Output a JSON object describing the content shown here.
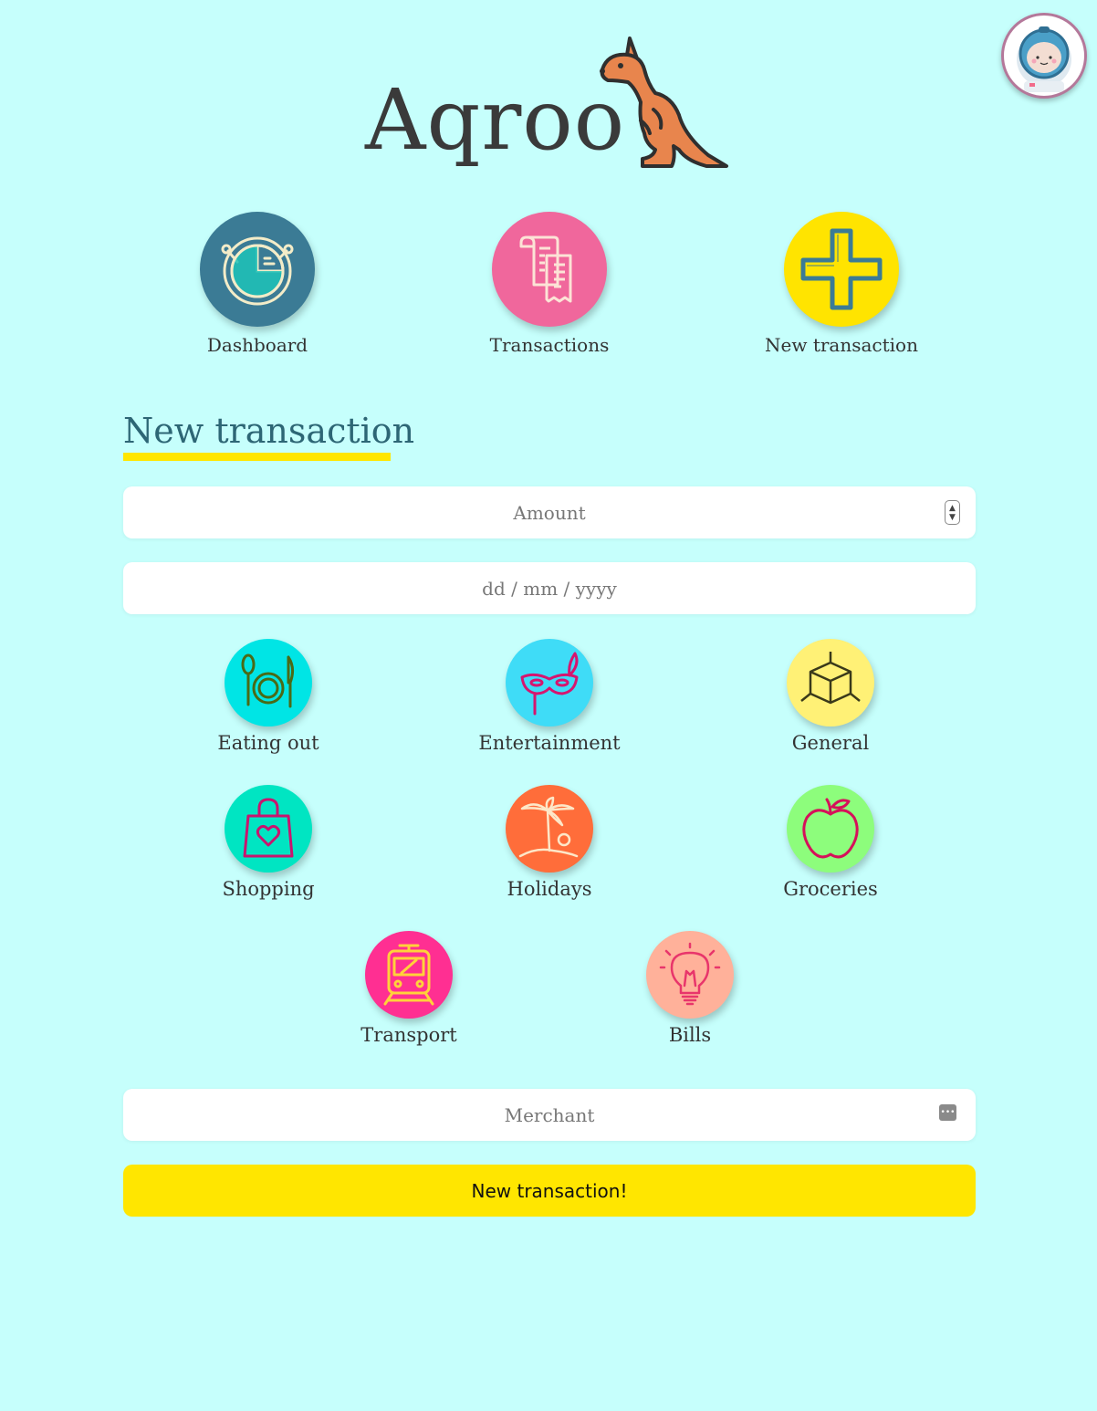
{
  "app": {
    "title": "Aqroo"
  },
  "nav": {
    "items": [
      {
        "label": "Dashboard",
        "color": "#3b7b95",
        "icon": "pie-chart-icon"
      },
      {
        "label": "Transactions",
        "color": "#f0679c",
        "icon": "receipt-icon"
      },
      {
        "label": "New transaction",
        "color": "#ffe400",
        "icon": "plus-icon"
      }
    ]
  },
  "form": {
    "title": "New transaction",
    "amount_placeholder": "Amount",
    "date_placeholder": "dd / mm / yyyy",
    "merchant_placeholder": "Merchant",
    "submit_label": "New transaction!"
  },
  "categories": [
    {
      "label": "Eating out",
      "color": "#00e5e5",
      "icon": "cutlery-icon"
    },
    {
      "label": "Entertainment",
      "color": "#3fdcf7",
      "icon": "mask-icon"
    },
    {
      "label": "General",
      "color": "#fff176",
      "icon": "box-icon"
    },
    {
      "label": "Shopping",
      "color": "#00e5c2",
      "icon": "shopping-bag-icon"
    },
    {
      "label": "Holidays",
      "color": "#ff6d3a",
      "icon": "palm-tree-icon"
    },
    {
      "label": "Groceries",
      "color": "#8dfd7c",
      "icon": "apple-icon"
    },
    {
      "label": "Transport",
      "color": "#ff2f92",
      "icon": "train-icon"
    },
    {
      "label": "Bills",
      "color": "#ffb19a",
      "icon": "lightbulb-icon"
    }
  ]
}
